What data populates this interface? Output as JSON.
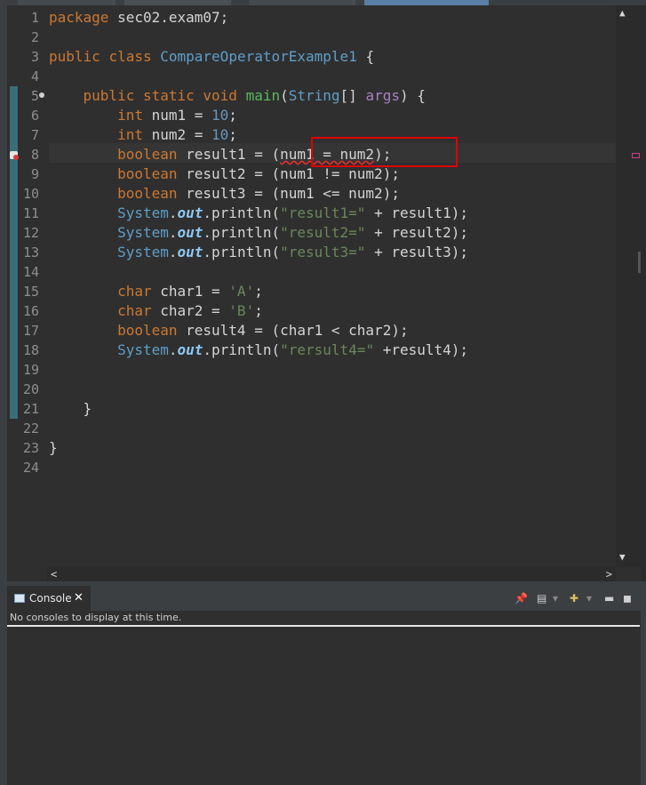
{
  "editor": {
    "line_numbers": [
      "1",
      "2",
      "3",
      "4",
      "5",
      "6",
      "7",
      "8",
      "9",
      "10",
      "11",
      "12",
      "13",
      "14",
      "15",
      "16",
      "17",
      "18",
      "19",
      "20",
      "21",
      "22",
      "23",
      "24"
    ],
    "code": {
      "l1_kw": "package",
      "l1_rest": " sec02.exam07;",
      "l3_kw1": "public",
      "l3_kw2": "class",
      "l3_cls": "CompareOperatorExample1",
      "l3_rest": " {",
      "l5_mods": "public static void",
      "l5_name": "main",
      "l5_type": "String",
      "l5_br": "[] ",
      "l5_arg": "args",
      "l5_end": ") {",
      "l6_type": "int",
      "l6_mid": " num1 = ",
      "l6_val": "10",
      "l6_end": ";",
      "l7_type": "int",
      "l7_mid": " num2 = ",
      "l7_val": "10",
      "l7_end": ";",
      "l8_type": "boolean",
      "l8_mid": " result1 = (",
      "l8_err": "num1 = num2",
      "l8_end": ");",
      "l9_type": "boolean",
      "l9_mid": " result2 = (num1 != num2);",
      "l10_type": "boolean",
      "l10_mid": " result3 = (num1 <= num2);",
      "l11_cls": "System",
      "l11_fld": "out",
      "l11_call": ".println(",
      "l11_str": "\"result1=\"",
      "l11_end": " + result1);",
      "l12_cls": "System",
      "l12_fld": "out",
      "l12_call": ".println(",
      "l12_str": "\"result2=\"",
      "l12_end": " + result2);",
      "l13_cls": "System",
      "l13_fld": "out",
      "l13_call": ".println(",
      "l13_str": "\"result3=\"",
      "l13_end": " + result3);",
      "l15_type": "char",
      "l15_mid": " char1 = ",
      "l15_str": "'A'",
      "l15_end": ";",
      "l16_type": "char",
      "l16_mid": " char2 = ",
      "l16_str": "'B'",
      "l16_end": ";",
      "l17_type": "boolean",
      "l17_mid": " result4 = (char1 < char2);",
      "l18_cls": "System",
      "l18_fld": "out",
      "l18_call": ".println(",
      "l18_str": "\"rersult4=\"",
      "l18_end": " +result4);",
      "l21": "}",
      "l23": "}"
    }
  },
  "console": {
    "tab_label": "Console",
    "close_glyph": "✕",
    "message": "No consoles to display at this time.",
    "toolbar": {
      "pin": "📌",
      "display": "▤",
      "open": "✚",
      "dropdown": "▾",
      "minimize": "▬",
      "maximize": "◼"
    }
  },
  "scrollbar": {
    "up": "▲",
    "down": "▼",
    "left": "<",
    "right": ">"
  },
  "colors": {
    "keyword": "#cc7832",
    "number": "#6897bb",
    "string": "#6a8759",
    "type": "#5f9ec8",
    "method": "#5cb85c",
    "field": "#8dc8f2",
    "highlight_box": "#e00000",
    "background": "#2f2f2f"
  }
}
